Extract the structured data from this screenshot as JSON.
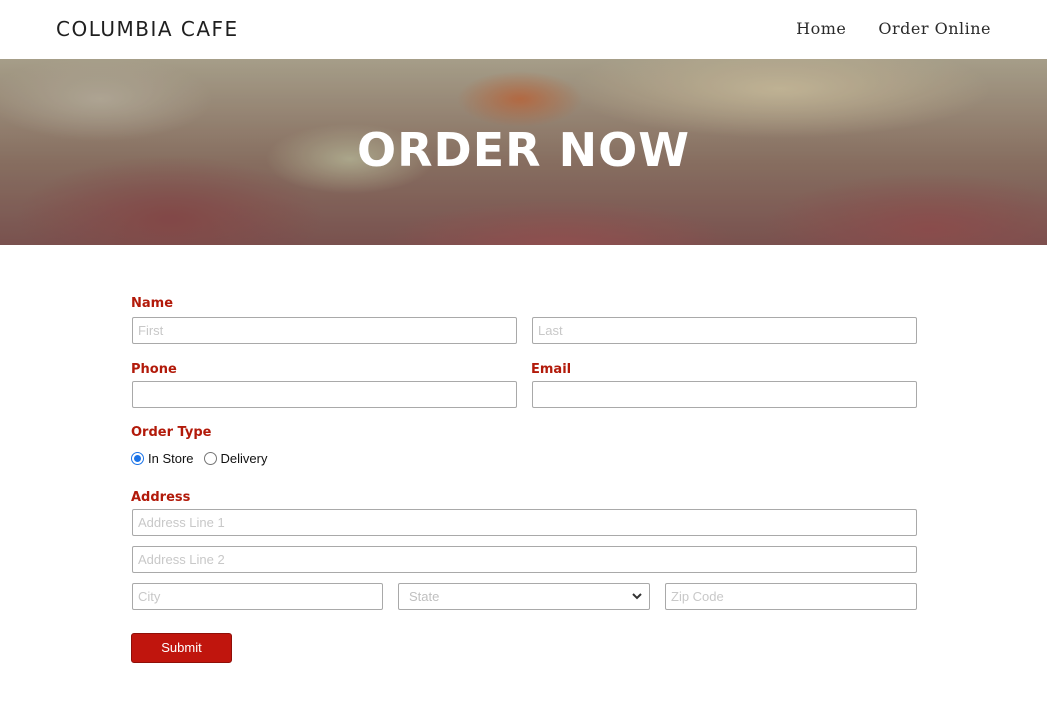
{
  "brand": {
    "name": "COLUMBIA CAFE"
  },
  "nav": {
    "items": [
      "Home",
      "Order Online"
    ]
  },
  "hero": {
    "title": "ORDER NOW"
  },
  "form": {
    "name_label": "Name",
    "first_placeholder": "First",
    "last_placeholder": "Last",
    "phone_label": "Phone",
    "email_label": "Email",
    "order_type_label": "Order Type",
    "order_type_options": [
      "In Store",
      "Delivery"
    ],
    "order_type_selected": "In Store",
    "address_label": "Address",
    "address1_placeholder": "Address Line 1",
    "address2_placeholder": "Address Line 2",
    "city_placeholder": "City",
    "state_placeholder": "State",
    "zip_placeholder": "Zip Code",
    "submit_label": "Submit"
  },
  "colors": {
    "label_red": "#b21a0a",
    "submit_red": "#c0150d",
    "radio_blue": "#1a73e8"
  }
}
